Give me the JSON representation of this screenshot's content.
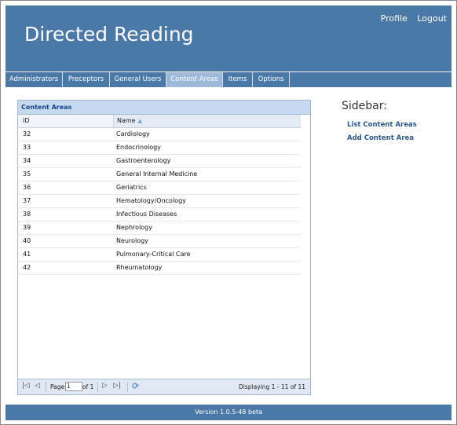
{
  "header": {
    "title": "Directed Reading",
    "links": [
      "Profile",
      "Logout"
    ]
  },
  "nav": {
    "tabs": [
      "Administrators",
      "Preceptors",
      "General Users",
      "Content Areas",
      "Items",
      "Options"
    ],
    "active": "Content Areas"
  },
  "grid": {
    "title": "Content Areas",
    "columns": [
      "ID",
      "Name"
    ],
    "sort_column": "Name",
    "sort_direction": "ascending",
    "rows": [
      {
        "id": "32",
        "name": "Cardiology"
      },
      {
        "id": "33",
        "name": "Endocrinology"
      },
      {
        "id": "34",
        "name": "Gastroenterology"
      },
      {
        "id": "35",
        "name": "General Internal Medicine"
      },
      {
        "id": "36",
        "name": "Geriatrics"
      },
      {
        "id": "37",
        "name": "Hematology/Oncology"
      },
      {
        "id": "38",
        "name": "Infectious Diseases"
      },
      {
        "id": "39",
        "name": "Nephrology"
      },
      {
        "id": "40",
        "name": "Neurology"
      },
      {
        "id": "41",
        "name": "Pulmonary-Critical Care"
      },
      {
        "id": "42",
        "name": "Rheumatology"
      }
    ]
  },
  "pager": {
    "page_label": "Page",
    "page_value": "1",
    "of_label": "of 1",
    "display_text": "Displaying 1 - 11 of 11",
    "icons": {
      "first": "first-page-icon",
      "prev": "previous-page-icon",
      "next": "next-page-icon",
      "last": "last-page-icon",
      "refresh": "refresh-icon"
    }
  },
  "sidebar": {
    "title": "Sidebar:",
    "links": [
      "List Content Areas",
      "Add Content Area"
    ]
  },
  "footer": {
    "version": "Version 1.0.5-48 beta"
  },
  "colors": {
    "header_blue": "#4a79a8",
    "active_tab": "#9db9d9",
    "grid_header": "#c5d9ef",
    "link": "#2b5a8c"
  }
}
